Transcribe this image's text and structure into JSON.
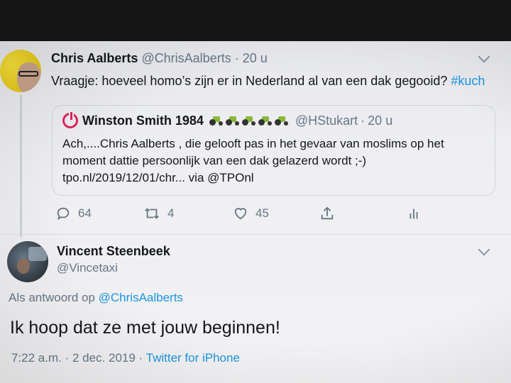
{
  "tweet": {
    "author_name": "Chris Aalberts",
    "author_handle": "@ChrisAalberts",
    "time": "20 u",
    "text_main": "Vraagje: hoeveel homo’s zijn er in Nederland al van een dak gegooid?",
    "hashtag": "#kuch",
    "quoted": {
      "name": "Winston Smith 1984",
      "handle": "@HStukart",
      "time": "20 u",
      "icon": "power-icon",
      "emoji_icons": [
        "tractor-icon",
        "tractor-icon",
        "tractor-icon",
        "tractor-icon",
        "tractor-icon"
      ],
      "lines": [
        "Ach,....Chris Aalberts , die gelooft pas in het gevaar van moslims op het",
        "moment dattie persoonlijk van een dak gelazerd wordt ;-)",
        "tpo.nl/2019/12/01/chr... via @TPOnl"
      ]
    },
    "actions": {
      "replies": "64",
      "retweets": "4",
      "likes": "45"
    }
  },
  "reply": {
    "author_name": "Vincent Steenbeek",
    "author_handle": "@Vincetaxi",
    "reply_prefix": "Als antwoord op",
    "reply_target": "@ChrisAalberts",
    "text": "Ik hoop dat ze met jouw beginnen!",
    "timestamp": "7:22 a.m. · 2 dec. 2019 ·",
    "source": "Twitter for iPhone"
  },
  "colors": {
    "link": "#1b95e0",
    "muted": "#657786",
    "text": "#14171a",
    "quote_icon": "#e0245e"
  }
}
